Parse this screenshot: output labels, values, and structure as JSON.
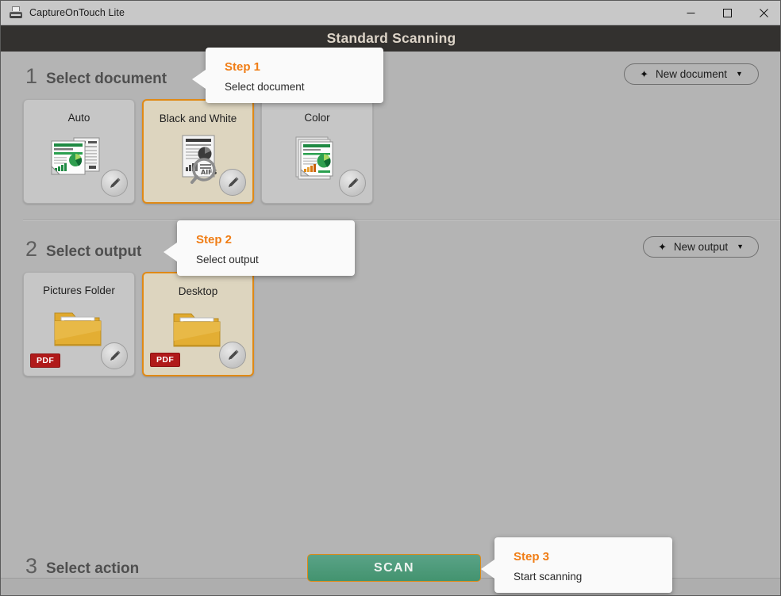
{
  "window": {
    "title": "CaptureOnTouch Lite",
    "app_icon": "scanner-icon",
    "minimize_label": "Minimize",
    "maximize_label": "Maximize",
    "close_label": "Close"
  },
  "header": {
    "title": "Standard Scanning"
  },
  "sections": [
    {
      "number": "1",
      "label": "Select document"
    },
    {
      "number": "2",
      "label": "Select output"
    },
    {
      "number": "3",
      "label": "Select action"
    }
  ],
  "toolbar": {
    "new_document": {
      "plus": "✦",
      "label": "New document",
      "caret": "▼"
    },
    "new_output": {
      "plus": "✦",
      "label": "New output",
      "caret": "▼"
    }
  },
  "documents": [
    {
      "title": "Auto",
      "selected": false,
      "art": "auto-pages",
      "edit_label": "Edit"
    },
    {
      "title": "Black and White",
      "selected": true,
      "art": "bw-page",
      "edit_label": "Edit"
    },
    {
      "title": "Color",
      "selected": false,
      "art": "color-pages",
      "edit_label": "Edit"
    }
  ],
  "outputs": [
    {
      "title": "Pictures Folder",
      "selected": false,
      "badge": "PDF",
      "art": "folder",
      "edit_label": "Edit"
    },
    {
      "title": "Desktop",
      "selected": true,
      "badge": "PDF",
      "art": "folder",
      "edit_label": "Edit"
    }
  ],
  "action": {
    "scan_label": "SCAN"
  },
  "callouts": [
    {
      "step": "Step 1",
      "desc": "Select document"
    },
    {
      "step": "Step 2",
      "desc": "Select output"
    },
    {
      "step": "Step 3",
      "desc": "Start scanning"
    }
  ],
  "colors": {
    "accent_orange": "#f07d15",
    "selected_card": "#ddd5bf",
    "selected_border": "#e08a16",
    "scan_green": "#43936f",
    "pdf_red": "#b01a1a",
    "header_bar": "#33312f",
    "body_bg": "#b4b4b4"
  }
}
